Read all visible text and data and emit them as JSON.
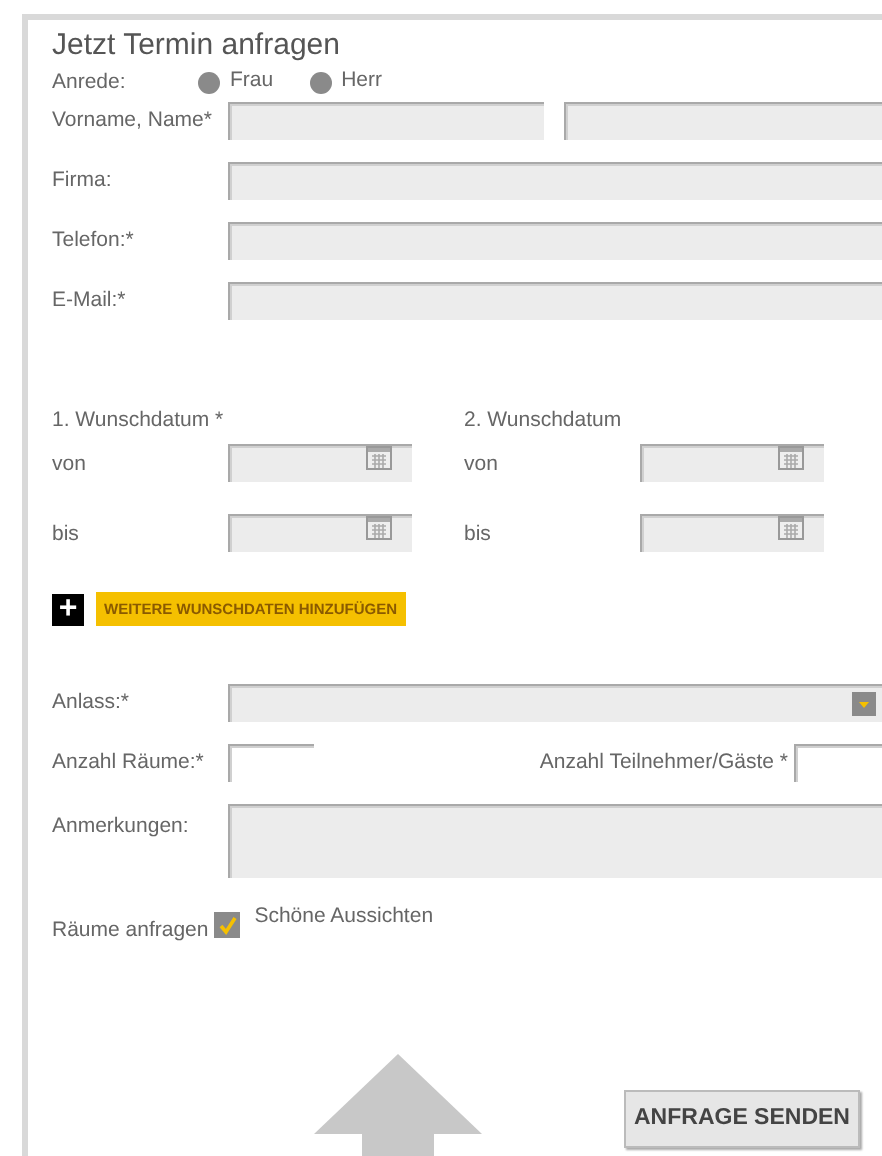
{
  "title": "Jetzt Termin anfragen",
  "salutation": {
    "label": "Anrede:",
    "options": [
      {
        "label": "Frau",
        "selected": false
      },
      {
        "label": "Herr",
        "selected": false
      }
    ]
  },
  "name": {
    "label": "Vorname, Name*"
  },
  "fields": [
    {
      "label": "Firma:"
    },
    {
      "label": "Telefon:*"
    },
    {
      "label": "E-Mail:*"
    }
  ],
  "dates": [
    {
      "heading": "1. Wunschdatum *",
      "from": "von",
      "to": "bis"
    },
    {
      "heading": "2. Wunschdatum",
      "from": "von",
      "to": "bis"
    }
  ],
  "add_button": {
    "icon": "+",
    "label": "WEITERE WUNSCHDATEN HINZUFÜGEN"
  },
  "occasion": {
    "label": "Anlass:*"
  },
  "rooms": {
    "label": "Anzahl Räume:*"
  },
  "guests": {
    "label": "Anzahl Teilnehmer/Gäste *"
  },
  "notes": {
    "label": "Anmerkungen:"
  },
  "request_rooms": {
    "label": "Räume anfragen",
    "option": "Schöne Aussichten",
    "checked": true
  },
  "submit": "ANFRAGE SENDEN"
}
